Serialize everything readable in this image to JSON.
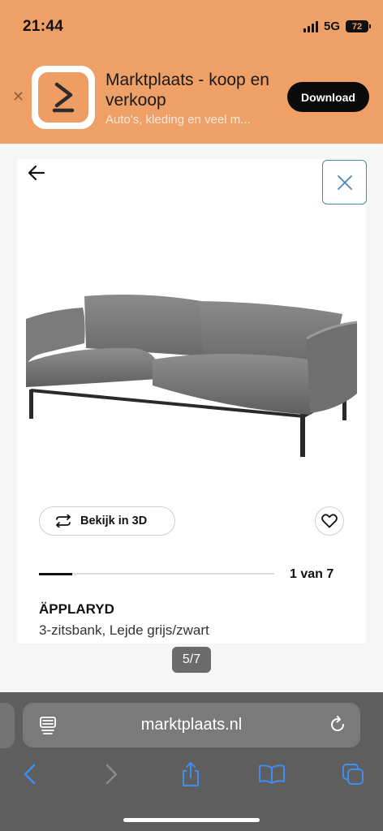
{
  "status": {
    "time": "21:44",
    "network": "5G",
    "battery": "72"
  },
  "banner": {
    "title": "Marktplaats - koop en verkoop",
    "subtitle": "Auto's, kleding en veel m...",
    "download_label": "Download"
  },
  "product": {
    "view_3d_label": "Bekijk in 3D",
    "page_count": "1 van 7",
    "progress_fraction": 0.14,
    "name": "ÄPPLARYD",
    "description": "3-zitsbank, Lejde grijs/zwart"
  },
  "gallery": {
    "counter": "5/7"
  },
  "browser": {
    "url": "marktplaats.nl"
  },
  "colors": {
    "banner": "#efa066",
    "accent_blue": "#4a86b0",
    "safari_bar": "#5e5e5e"
  }
}
